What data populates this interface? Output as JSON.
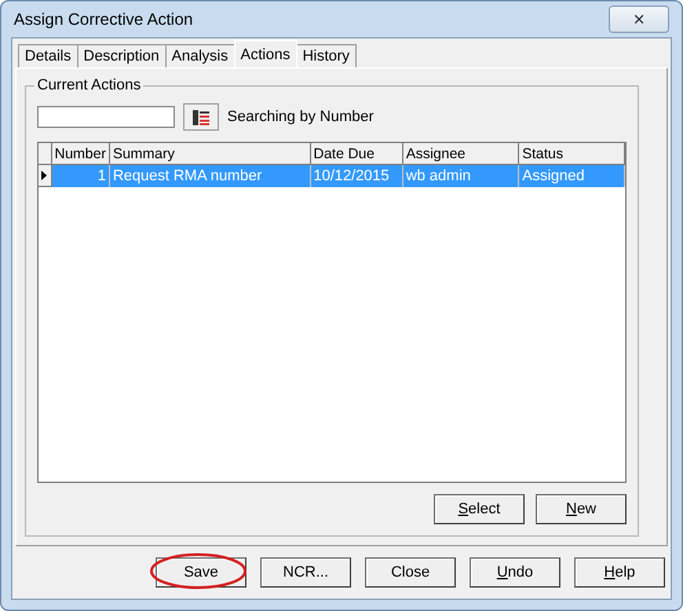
{
  "window": {
    "title": "Assign Corrective Action",
    "close": "✕"
  },
  "tabs": [
    {
      "label": "Details",
      "selected": false
    },
    {
      "label": "Description",
      "selected": false
    },
    {
      "label": "Analysis",
      "selected": false
    },
    {
      "label": "Actions",
      "selected": true
    },
    {
      "label": "History",
      "selected": false
    }
  ],
  "group": {
    "title": "Current Actions"
  },
  "search": {
    "status": "Searching by Number"
  },
  "table": {
    "columns": [
      "Number",
      "Summary",
      "Date Due",
      "Assignee",
      "Status"
    ],
    "rows": [
      {
        "selected": true,
        "cells": [
          "1",
          "Request RMA number",
          "10/12/2015",
          "wb admin",
          "Assigned"
        ]
      }
    ]
  },
  "panel_buttons": [
    {
      "label": "Select",
      "access_key": true
    },
    {
      "label": "New",
      "access_key": true
    }
  ],
  "buttons": [
    {
      "label": "Save",
      "access_key": false,
      "circled": true
    },
    {
      "label": "NCR...",
      "access_key": false,
      "circled": false
    },
    {
      "label": "Close",
      "access_key": false,
      "circled": false
    },
    {
      "label": "Undo",
      "access_key": true,
      "circled": false
    },
    {
      "label": "Help",
      "access_key": true,
      "circled": false
    }
  ]
}
